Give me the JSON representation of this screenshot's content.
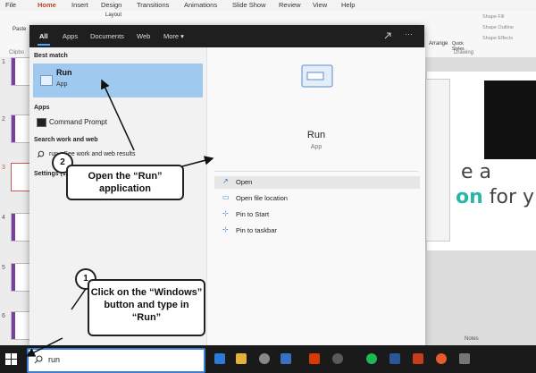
{
  "powerpoint": {
    "tabs": [
      "File",
      "Home",
      "Insert",
      "Design",
      "Transitions",
      "Animations",
      "Slide Show",
      "Review",
      "View",
      "Help"
    ],
    "ribbon": {
      "paste": "Paste",
      "clipboard": "Clipbo",
      "layout": "Layout",
      "arrange": "Arrange",
      "quick_styles": "Quick Styles",
      "shape_fill": "Shape Fill",
      "shape_outline": "Shape Outline",
      "shape_effects": "Shape Effects",
      "drawing": "Drawing"
    },
    "slide_numbers": [
      "1",
      "2",
      "3",
      "4",
      "5",
      "6"
    ],
    "slide_text_line1": "e a",
    "slide_text_line2a": "on",
    "slide_text_line2b": " for y",
    "notes": "Notes"
  },
  "start_menu": {
    "scopes": [
      "All",
      "Apps",
      "Documents",
      "Web",
      "More ▾"
    ],
    "best_match_header": "Best match",
    "best_match": {
      "name": "Run",
      "type": "App"
    },
    "apps_header": "Apps",
    "apps": [
      "Command Prompt"
    ],
    "search_web_header": "Search work and web",
    "web_result": "run - See work and web results",
    "settings_header": "Settings (1)",
    "preview": {
      "name": "Run",
      "type": "App",
      "actions": [
        "Open",
        "Open file location",
        "Pin to Start",
        "Pin to taskbar"
      ]
    }
  },
  "taskbar": {
    "search_value": "run"
  },
  "callouts": {
    "step1": {
      "number": "1",
      "text": "Click on the “Windows” button and type in “Run”"
    },
    "step2": {
      "number": "2",
      "text": "Open the “Run” application"
    }
  },
  "colors": {
    "accent": "#4aa3ff",
    "highlight": "#9fc9ef",
    "taskbar": "#1a1a1a"
  }
}
